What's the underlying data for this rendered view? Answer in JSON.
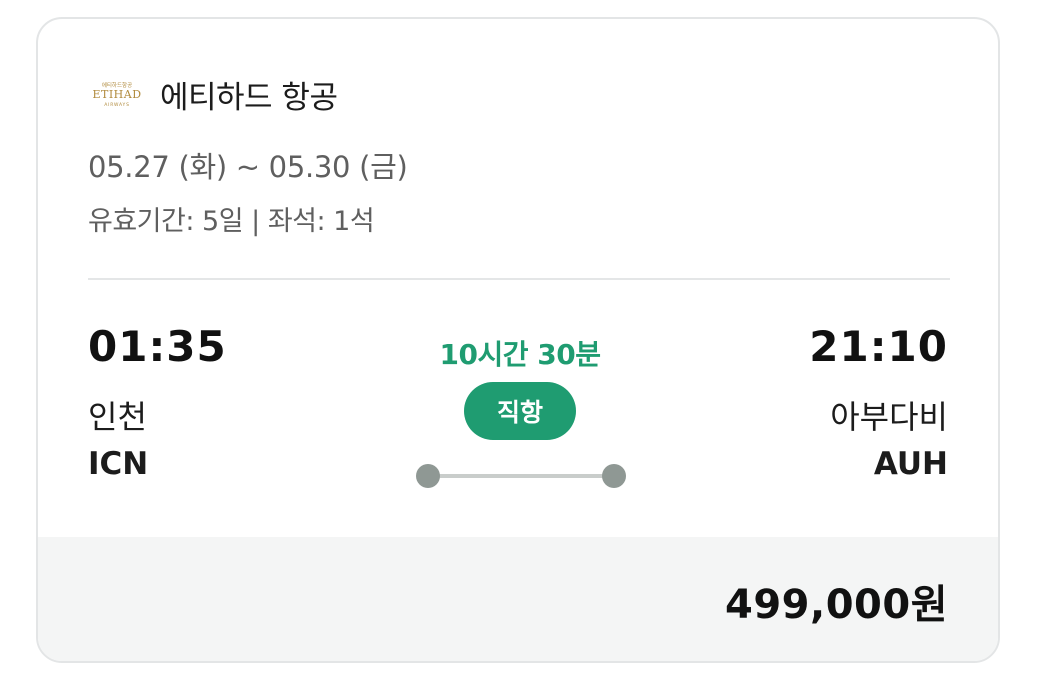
{
  "airline": {
    "name": "에티하드 항공",
    "logo": {
      "icon": "etihad-logo-icon",
      "wordmark": "ETIHAD",
      "subtext": "AIRWAYS",
      "korean_text": "에티하드항공",
      "color": "#b08a3c"
    }
  },
  "trip": {
    "dates": "05.27 (화) ~ 05.30 (금)",
    "validity": "유효기간: 5일 | 좌석: 1석"
  },
  "departure": {
    "time": "01:35",
    "city": "인천",
    "code": "ICN"
  },
  "arrival": {
    "time": "21:10",
    "city": "아부다비",
    "code": "AUH"
  },
  "flight": {
    "duration": "10시간 30분",
    "type": "직항"
  },
  "price": "499,000원",
  "colors": {
    "accent": "#1f9c71",
    "route_dot": "#8f9894",
    "route_line": "#c9cdcb",
    "price_bg": "#f4f5f5",
    "border": "#e3e5e6"
  }
}
